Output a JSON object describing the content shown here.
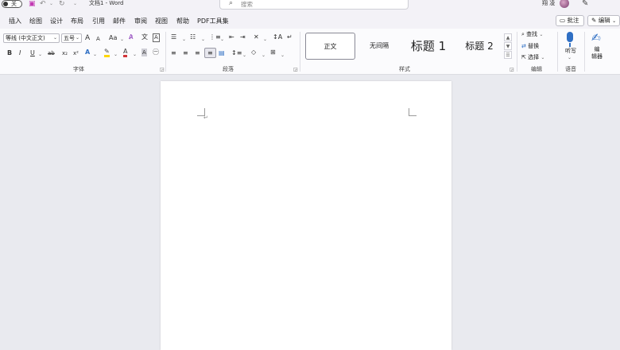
{
  "titlebar": {
    "autosave_label": "关",
    "doc_title": "文档1 - Word",
    "search_placeholder": "搜索",
    "user_name": "翔 凌"
  },
  "menu": {
    "tabs": [
      "插入",
      "绘图",
      "设计",
      "布局",
      "引用",
      "邮件",
      "审阅",
      "视图",
      "帮助",
      "PDF工具集"
    ],
    "comment_button": "批注",
    "edit_button": "编辑"
  },
  "ribbon": {
    "font": {
      "group_label": "字体",
      "font_name": "等线 (中文正文)",
      "font_size": "五号",
      "grow_label": "A",
      "shrink_label": "A",
      "case_label": "Aa",
      "bold": "B",
      "italic": "I",
      "underline": "U",
      "strike": "ab",
      "subscript": "x₂",
      "superscript": "x²",
      "font_color_letter": "A",
      "font_color": "#d13438",
      "highlight_color": "#ffd700"
    },
    "paragraph": {
      "group_label": "段落"
    },
    "styles": {
      "group_label": "样式",
      "items": [
        "正文",
        "无间隔",
        "标题 1",
        "标题 2"
      ]
    },
    "editing": {
      "group_label": "编辑",
      "find": "查找",
      "replace": "替换",
      "select": "选择"
    },
    "voice": {
      "group_label": "语音",
      "dictate": "听写"
    },
    "editor": {
      "label": "编\n辑器"
    }
  },
  "document": {
    "paragraph_mark": "↵"
  },
  "colors": {
    "accent": "#2f6fc4",
    "ribbon_bg": "#fbfbfd",
    "canvas_bg": "#e9eaef"
  }
}
